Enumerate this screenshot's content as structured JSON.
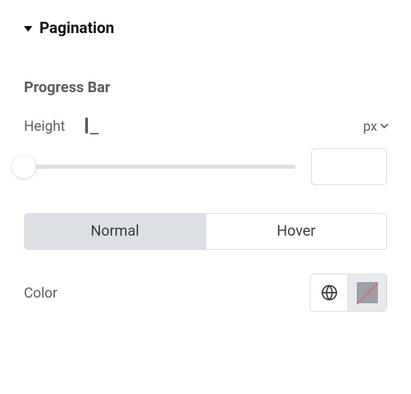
{
  "section": {
    "title": "Pagination"
  },
  "progress_bar": {
    "heading": "Progress Bar"
  },
  "height": {
    "label": "Height",
    "unit": "px",
    "value": ""
  },
  "states": {
    "normal": "Normal",
    "hover": "Hover",
    "active": "normal"
  },
  "color": {
    "label": "Color"
  }
}
